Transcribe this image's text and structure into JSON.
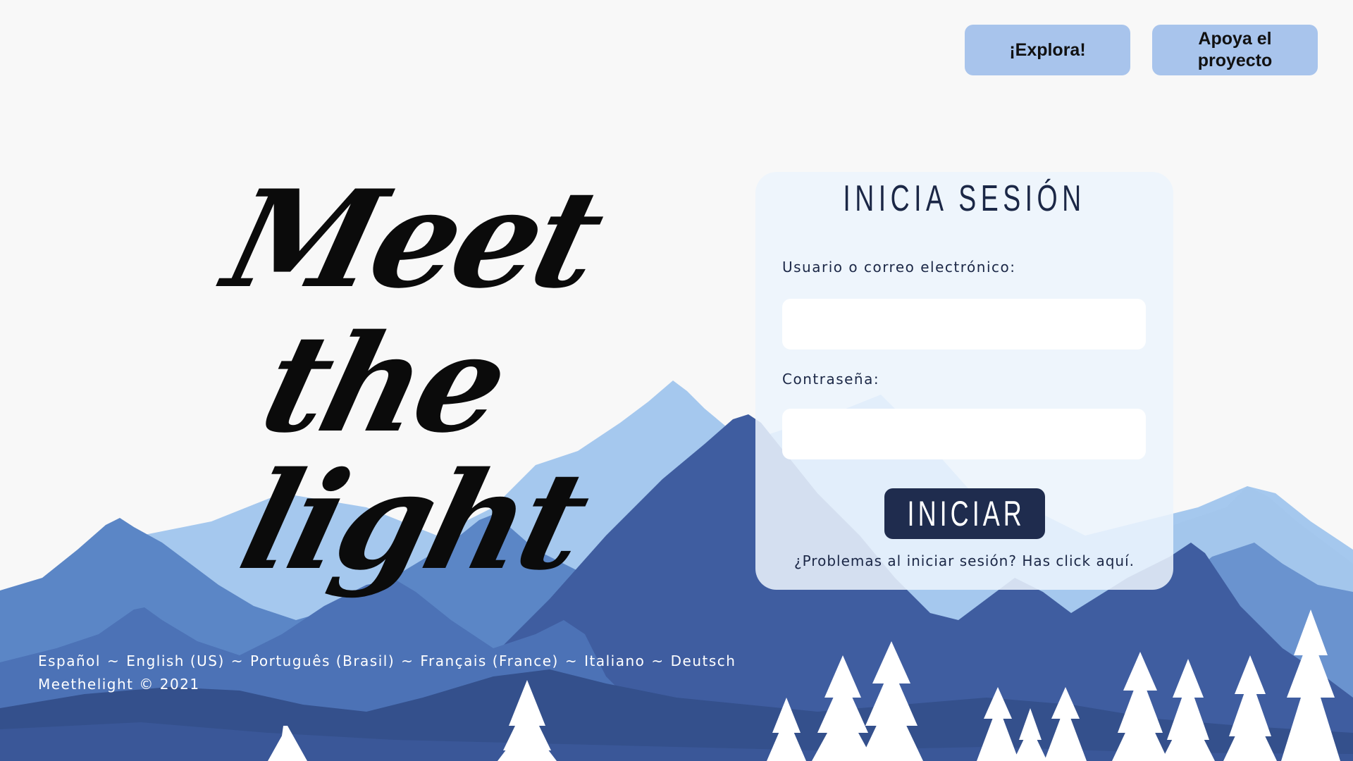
{
  "header": {
    "explore_label": "¡Explora!",
    "support_label": "Apoya el proyecto"
  },
  "logo": {
    "line1": "Meet",
    "line2": "the",
    "line3": "light"
  },
  "login": {
    "title": "INICIA SESIÓN",
    "user_label": "Usuario o correo electrónico:",
    "user_value": "",
    "password_label": "Contraseña:",
    "password_value": "",
    "submit_label": "INICIAR",
    "help_text": "¿Problemas al iniciar sesión? Has click aquí."
  },
  "footer": {
    "languages": [
      "Español",
      "English (US)",
      "Português (Brasil)",
      "Français (France)",
      "Italiano",
      "Deutsch"
    ],
    "separator": "~",
    "copyright": "Meethelight © 2021"
  },
  "colors": {
    "background": "#f8f8f8",
    "button_light": "#a8c4ec",
    "button_dark": "#1f2c4e",
    "text_dark": "#1b2746",
    "mountain_light": "#a4c8ee",
    "mountain_mid": "#5a84c4",
    "mountain_dark": "#33508f"
  }
}
